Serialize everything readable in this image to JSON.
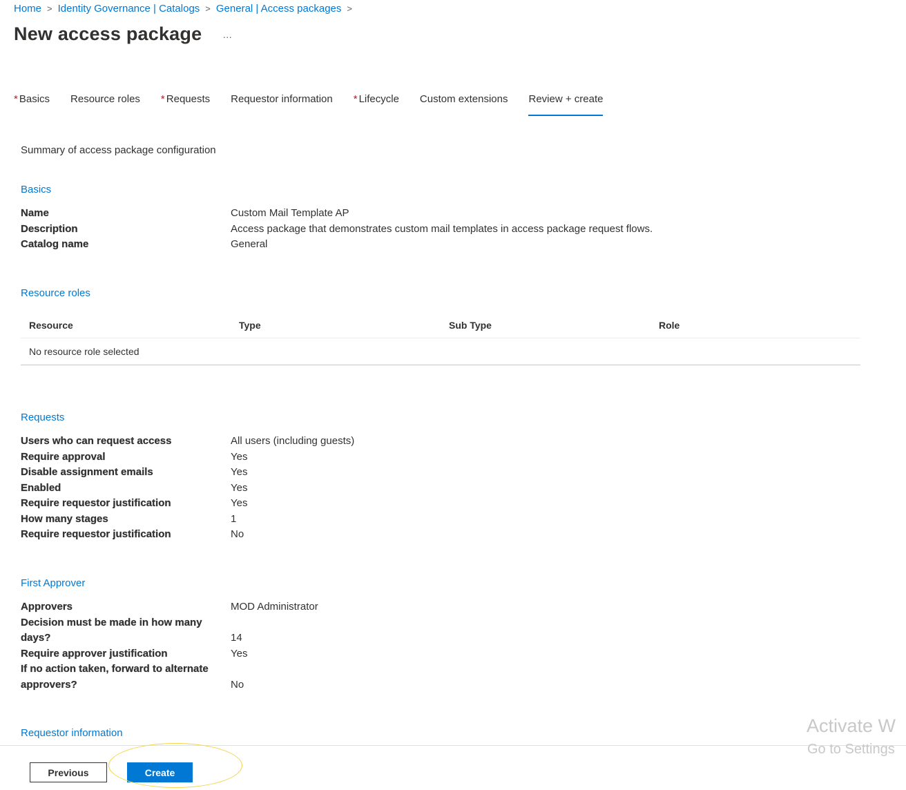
{
  "breadcrumb": [
    {
      "label": "Home"
    },
    {
      "label": "Identity Governance | Catalogs"
    },
    {
      "label": "General | Access packages"
    }
  ],
  "page": {
    "title": "New access package",
    "more_icon": "…"
  },
  "tabs": [
    {
      "label": "Basics",
      "required": true
    },
    {
      "label": "Resource roles",
      "required": false
    },
    {
      "label": "Requests",
      "required": true
    },
    {
      "label": "Requestor information",
      "required": false
    },
    {
      "label": "Lifecycle",
      "required": true
    },
    {
      "label": "Custom extensions",
      "required": false
    },
    {
      "label": "Review + create",
      "required": false,
      "active": true
    }
  ],
  "summary": "Summary of access package configuration",
  "basics": {
    "heading": "Basics",
    "rows": [
      {
        "key": "Name",
        "value": "Custom Mail Template AP"
      },
      {
        "key": "Description",
        "value": "Access package that demonstrates custom mail templates in access package request flows."
      },
      {
        "key": "Catalog name",
        "value": "General"
      }
    ]
  },
  "resource_roles": {
    "heading": "Resource roles",
    "columns": [
      "Resource",
      "Type",
      "Sub Type",
      "Role"
    ],
    "empty_text": "No resource role selected"
  },
  "requests": {
    "heading": "Requests",
    "rows": [
      {
        "key": "Users who can request access",
        "value": "All users (including guests)"
      },
      {
        "key": "Require approval",
        "value": "Yes"
      },
      {
        "key": "Disable assignment emails",
        "value": "Yes"
      },
      {
        "key": "Enabled",
        "value": "Yes"
      },
      {
        "key": "Require requestor justification",
        "value": "Yes"
      },
      {
        "key": "How many stages",
        "value": "1"
      },
      {
        "key": "Require requestor justification",
        "value": "No"
      }
    ]
  },
  "first_approver": {
    "heading": "First Approver",
    "rows": [
      {
        "key": "Approvers",
        "value": "MOD Administrator"
      },
      {
        "key_line1": "Decision must be made in how many",
        "key_line2": "days?",
        "value": "14"
      },
      {
        "key": "Require approver justification",
        "value": "Yes"
      },
      {
        "key_line1": "If no action taken, forward to alternate",
        "key_line2": "approvers?",
        "value": "No"
      }
    ]
  },
  "requestor_information": {
    "heading": "Requestor information"
  },
  "footer": {
    "previous_label": "Previous",
    "create_label": "Create"
  },
  "watermark": {
    "line1": "Activate W",
    "line2": "Go to Settings"
  },
  "colors": {
    "accent": "#0078d4",
    "required": "#a4262c",
    "highlight_ellipse": "#f2d54a"
  }
}
